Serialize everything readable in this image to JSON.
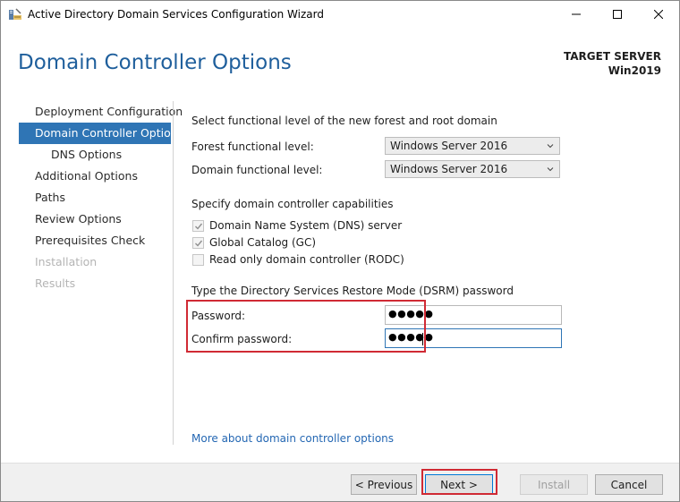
{
  "window": {
    "title": "Active Directory Domain Services Configuration Wizard"
  },
  "header": {
    "page_title": "Domain Controller Options",
    "target_server_label": "TARGET SERVER",
    "target_server_name": "Win2019"
  },
  "nav": {
    "items": [
      {
        "label": "Deployment Configuration",
        "state": "normal"
      },
      {
        "label": "Domain Controller Options",
        "state": "active"
      },
      {
        "label": "DNS Options",
        "state": "normal"
      },
      {
        "label": "Additional Options",
        "state": "normal"
      },
      {
        "label": "Paths",
        "state": "normal"
      },
      {
        "label": "Review Options",
        "state": "normal"
      },
      {
        "label": "Prerequisites Check",
        "state": "normal"
      },
      {
        "label": "Installation",
        "state": "disabled"
      },
      {
        "label": "Results",
        "state": "disabled"
      }
    ]
  },
  "functional_level": {
    "heading": "Select functional level of the new forest and root domain",
    "forest_label": "Forest functional level:",
    "forest_value": "Windows Server 2016",
    "domain_label": "Domain functional level:",
    "domain_value": "Windows Server 2016"
  },
  "capabilities": {
    "heading": "Specify domain controller capabilities",
    "dns": {
      "label": "Domain Name System (DNS) server",
      "checked": true
    },
    "gc": {
      "label": "Global Catalog (GC)",
      "checked": true
    },
    "rodc": {
      "label": "Read only domain controller (RODC)",
      "checked": false
    }
  },
  "dsrm": {
    "heading": "Type the Directory Services Restore Mode (DSRM) password",
    "password_label": "Password:",
    "password_value": "●●●●●",
    "confirm_label": "Confirm password:",
    "confirm_value": "●●●●●"
  },
  "more_link": "More about domain controller options",
  "buttons": {
    "previous": "< Previous",
    "next": "Next >",
    "install": "Install",
    "cancel": "Cancel"
  },
  "colors": {
    "accent": "#2f75b5",
    "title": "#1f5f9c",
    "annotation": "#d02a34",
    "link": "#2467b3"
  },
  "icons": [
    "ad-ds-wizard-icon",
    "minimize-icon",
    "maximize-icon",
    "close-icon",
    "chevron-down-icon",
    "checkmark-icon"
  ]
}
